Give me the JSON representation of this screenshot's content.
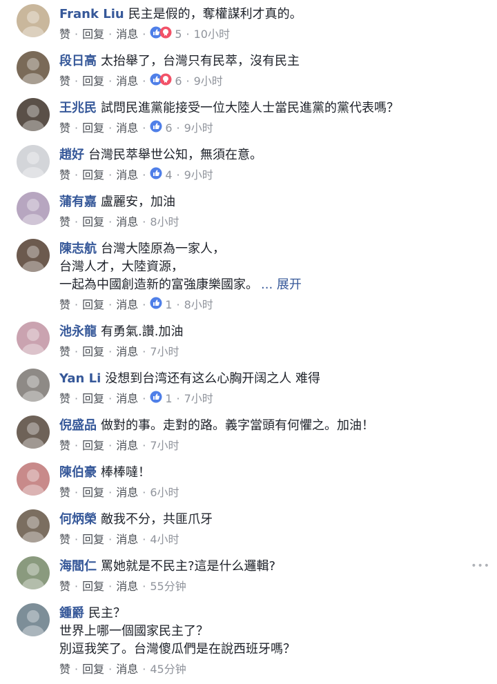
{
  "action_labels": {
    "like": "赞",
    "reply": "回复",
    "message": "消息"
  },
  "comments": [
    {
      "author": "Frank Liu",
      "lines": [
        "民主是假的，奪權謀利才真的。"
      ],
      "reactions": "both",
      "reaction_count": "5",
      "time": "10小时",
      "avatar_color": "#c9b79c"
    },
    {
      "author": "段日高",
      "lines": [
        "太抬舉了，台灣只有民萃，沒有民主"
      ],
      "reactions": "both",
      "reaction_count": "6",
      "time": "9小时",
      "avatar_color": "#7a6a58"
    },
    {
      "author": "王兆民",
      "lines": [
        "試問民進黨能接受一位大陸人士當民進黨的黨代表嗎？"
      ],
      "reactions": "like",
      "reaction_count": "6",
      "time": "9小时",
      "avatar_color": "#5a5048"
    },
    {
      "author": "趙好",
      "lines": [
        "台灣民萃舉世公知，無須在意。"
      ],
      "reactions": "like",
      "reaction_count": "4",
      "time": "9小时",
      "avatar_color": "#d3d5d9"
    },
    {
      "author": "蒲有嘉",
      "lines": [
        "盧麗安，加油"
      ],
      "reactions": "none",
      "reaction_count": "",
      "time": "8小时",
      "avatar_color": "#b7a6c0"
    },
    {
      "author": "陳志航",
      "lines": [
        "台灣大陸原為一家人，",
        "台灣人才，大陸資源，",
        "一起為中國創造新的富強康樂國家。"
      ],
      "more": "... 展开",
      "reactions": "like",
      "reaction_count": "1",
      "time": "8小时",
      "avatar_color": "#6c5a4e"
    },
    {
      "author": "池永龍",
      "lines": [
        "有勇氣.讚.加油"
      ],
      "reactions": "none",
      "reaction_count": "",
      "time": "7小时",
      "avatar_color": "#caa3b0"
    },
    {
      "author": "Yan Li",
      "lines": [
        "没想到台湾还有这么心胸开阔之人 难得"
      ],
      "reactions": "like",
      "reaction_count": "1",
      "time": "7小时",
      "avatar_color": "#8e8a86"
    },
    {
      "author": "倪盛品",
      "lines": [
        "做對的事。走對的路。義字當頭有何懼之。加油！"
      ],
      "reactions": "none",
      "reaction_count": "",
      "time": "7小时",
      "avatar_color": "#6e6258"
    },
    {
      "author": "陳伯豪",
      "lines": [
        "棒棒噠！"
      ],
      "reactions": "none",
      "reaction_count": "",
      "time": "6小时",
      "avatar_color": "#c88a8a"
    },
    {
      "author": "何炳榮",
      "lines": [
        "敵我不分，共匪爪牙"
      ],
      "reactions": "none",
      "reaction_count": "",
      "time": "4小时",
      "avatar_color": "#7b6e60"
    },
    {
      "author": "海閻仁",
      "lines": [
        "罵她就是不民主?這是什么邏輯?"
      ],
      "reactions": "none",
      "reaction_count": "",
      "time": "55分钟",
      "avatar_color": "#8a9a7e"
    },
    {
      "author": "鍾爵",
      "lines": [
        "民主？",
        "世界上哪一個國家民主了？",
        "別逗我笑了。台灣傻瓜們是在說西班牙嗎？"
      ],
      "reactions": "none",
      "reaction_count": "",
      "time": "45分钟",
      "avatar_color": "#7d8e98"
    }
  ],
  "colors": {
    "name": "#365899",
    "like_blue": "#4f7fe8",
    "haha_red": "#f25268"
  }
}
